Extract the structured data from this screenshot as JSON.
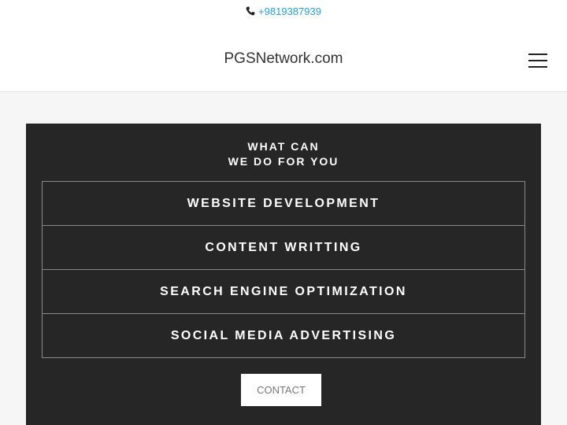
{
  "header": {
    "phone_icon": "phone-icon",
    "phone": "+9819387939",
    "brand": "PGSNetwork.com",
    "menu_icon": "hamburger-menu-icon"
  },
  "panel": {
    "heading_line1": "WHAT CAN",
    "heading_line2": "WE DO FOR YOU",
    "services": [
      "WEBSITE DEVELOPMENT",
      "CONTENT WRITTING",
      "SEARCH ENGINE OPTIMIZATION",
      "SOCIAL MEDIA ADVERTISING"
    ],
    "contact_label": "CONTACT"
  },
  "colors": {
    "link": "#2a9fd6",
    "panel_bg": "#262626",
    "page_bg": "#f6f6f6"
  }
}
